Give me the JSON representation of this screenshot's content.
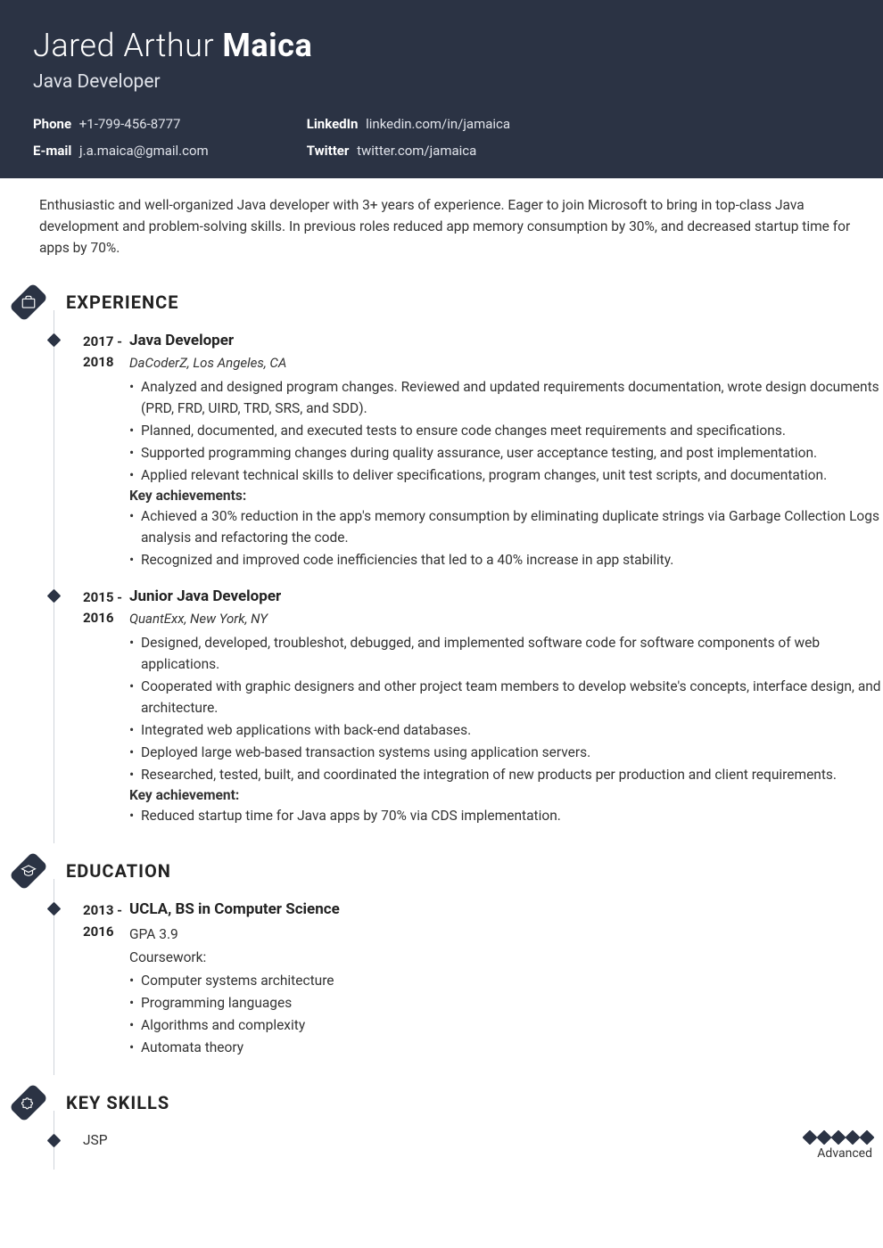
{
  "header": {
    "first_middle": "Jared Arthur",
    "last": "Maica",
    "title": "Java Developer",
    "contacts": {
      "phone_label": "Phone",
      "phone": "+1-799-456-8777",
      "email_label": "E-mail",
      "email": "j.a.maica@gmail.com",
      "linkedin_label": "LinkedIn",
      "linkedin": "linkedin.com/in/jamaica",
      "twitter_label": "Twitter",
      "twitter": "twitter.com/jamaica"
    }
  },
  "summary": "Enthusiastic and well-organized Java developer with 3+ years of experience. Eager to join Microsoft to bring in top-class Java development and problem-solving skills. In previous roles reduced app memory consumption by 30%, and decreased startup time for apps by 70%.",
  "sections": {
    "experience": {
      "title": "EXPERIENCE",
      "entries": [
        {
          "date": "2017 - 2018",
          "title": "Java Developer",
          "sub": "DaCoderZ, Los Angeles, CA",
          "bullets": [
            "Analyzed and designed program changes. Reviewed and updated requirements documentation, wrote design documents (PRD, FRD, UIRD, TRD, SRS, and SDD).",
            "Planned, documented, and executed tests to ensure code changes meet requirements and specifications.",
            "Supported programming changes during quality assurance, user acceptance testing, and post implementation.",
            "Applied relevant technical skills to deliver specifications, program changes, unit test scripts, and documentation."
          ],
          "ach_label": "Key achievements:",
          "achievements": [
            "Achieved a 30% reduction in the app's memory consumption by eliminating duplicate strings via Garbage Collection Logs analysis and refactoring the code.",
            "Recognized and improved code inefficiencies that led to a 40% increase in app stability."
          ]
        },
        {
          "date": "2015 - 2016",
          "title": "Junior Java Developer",
          "sub": "QuantExx, New York, NY",
          "bullets": [
            "Designed, developed, troubleshot, debugged, and implemented software code for software components of web applications.",
            "Cooperated with graphic designers and other project team members to develop website's concepts, interface design, and architecture.",
            "Integrated web applications with back-end databases.",
            "Deployed large web-based transaction systems using application servers.",
            "Researched, tested, built, and coordinated the integration of new products per production and client requirements."
          ],
          "ach_label": "Key achievement:",
          "achievements": [
            "Reduced startup time for Java apps by 70% via CDS implementation."
          ]
        }
      ]
    },
    "education": {
      "title": "EDUCATION",
      "entries": [
        {
          "date": "2013 - 2016",
          "title": "UCLA, BS in Computer Science",
          "gpa": "GPA 3.9",
          "coursework_label": "Coursework:",
          "bullets": [
            "Computer systems architecture",
            "Programming languages",
            "Algorithms and complexity",
            "Automata theory"
          ]
        }
      ]
    },
    "skills": {
      "title": "KEY SKILLS",
      "entries": [
        {
          "name": "JSP",
          "rating": 5,
          "level": "Advanced"
        }
      ]
    }
  }
}
